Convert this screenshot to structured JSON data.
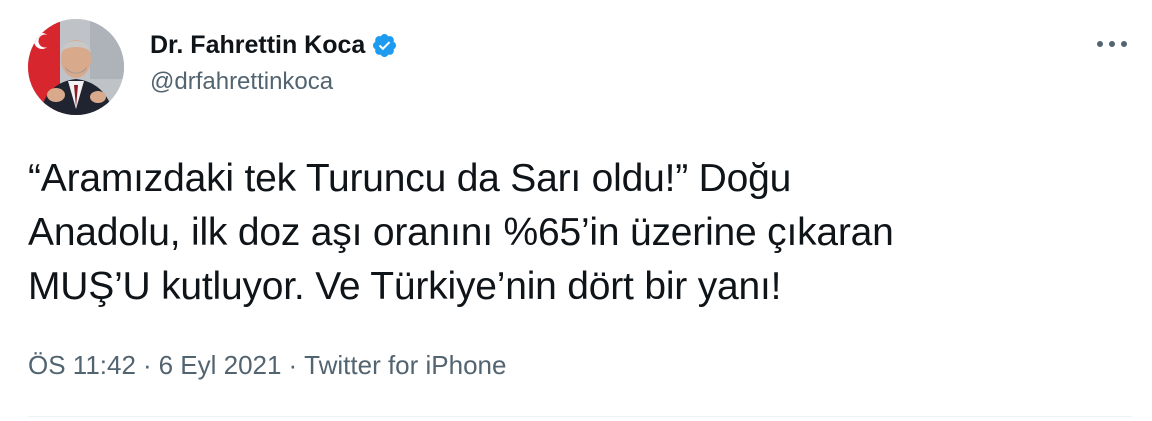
{
  "author": {
    "display_name": "Dr. Fahrettin Koca",
    "handle": "@drfahrettinkoca",
    "verified": true,
    "verified_icon": "verified-badge-icon",
    "verified_color": "#1d9bf0"
  },
  "tweet": {
    "text": "“Aramızdaki tek Turuncu da Sarı oldu!” Doğu\nAnadolu, ilk doz aşı oranını %65’in üzerine çıkaran\nMUŞ’U kutluyor. Ve Türkiye’nin dört bir yanı!"
  },
  "meta": {
    "time": "ÖS 11:42",
    "separator": "·",
    "date": "6 Eyl 2021",
    "source": "Twitter for iPhone"
  },
  "icons": {
    "more": "more-horizontal-icon",
    "avatar": "profile-photo"
  },
  "colors": {
    "text_primary": "#0f1419",
    "text_secondary": "#536471",
    "divider": "#eff3f4",
    "avatar_flag_red": "#d7262e"
  }
}
